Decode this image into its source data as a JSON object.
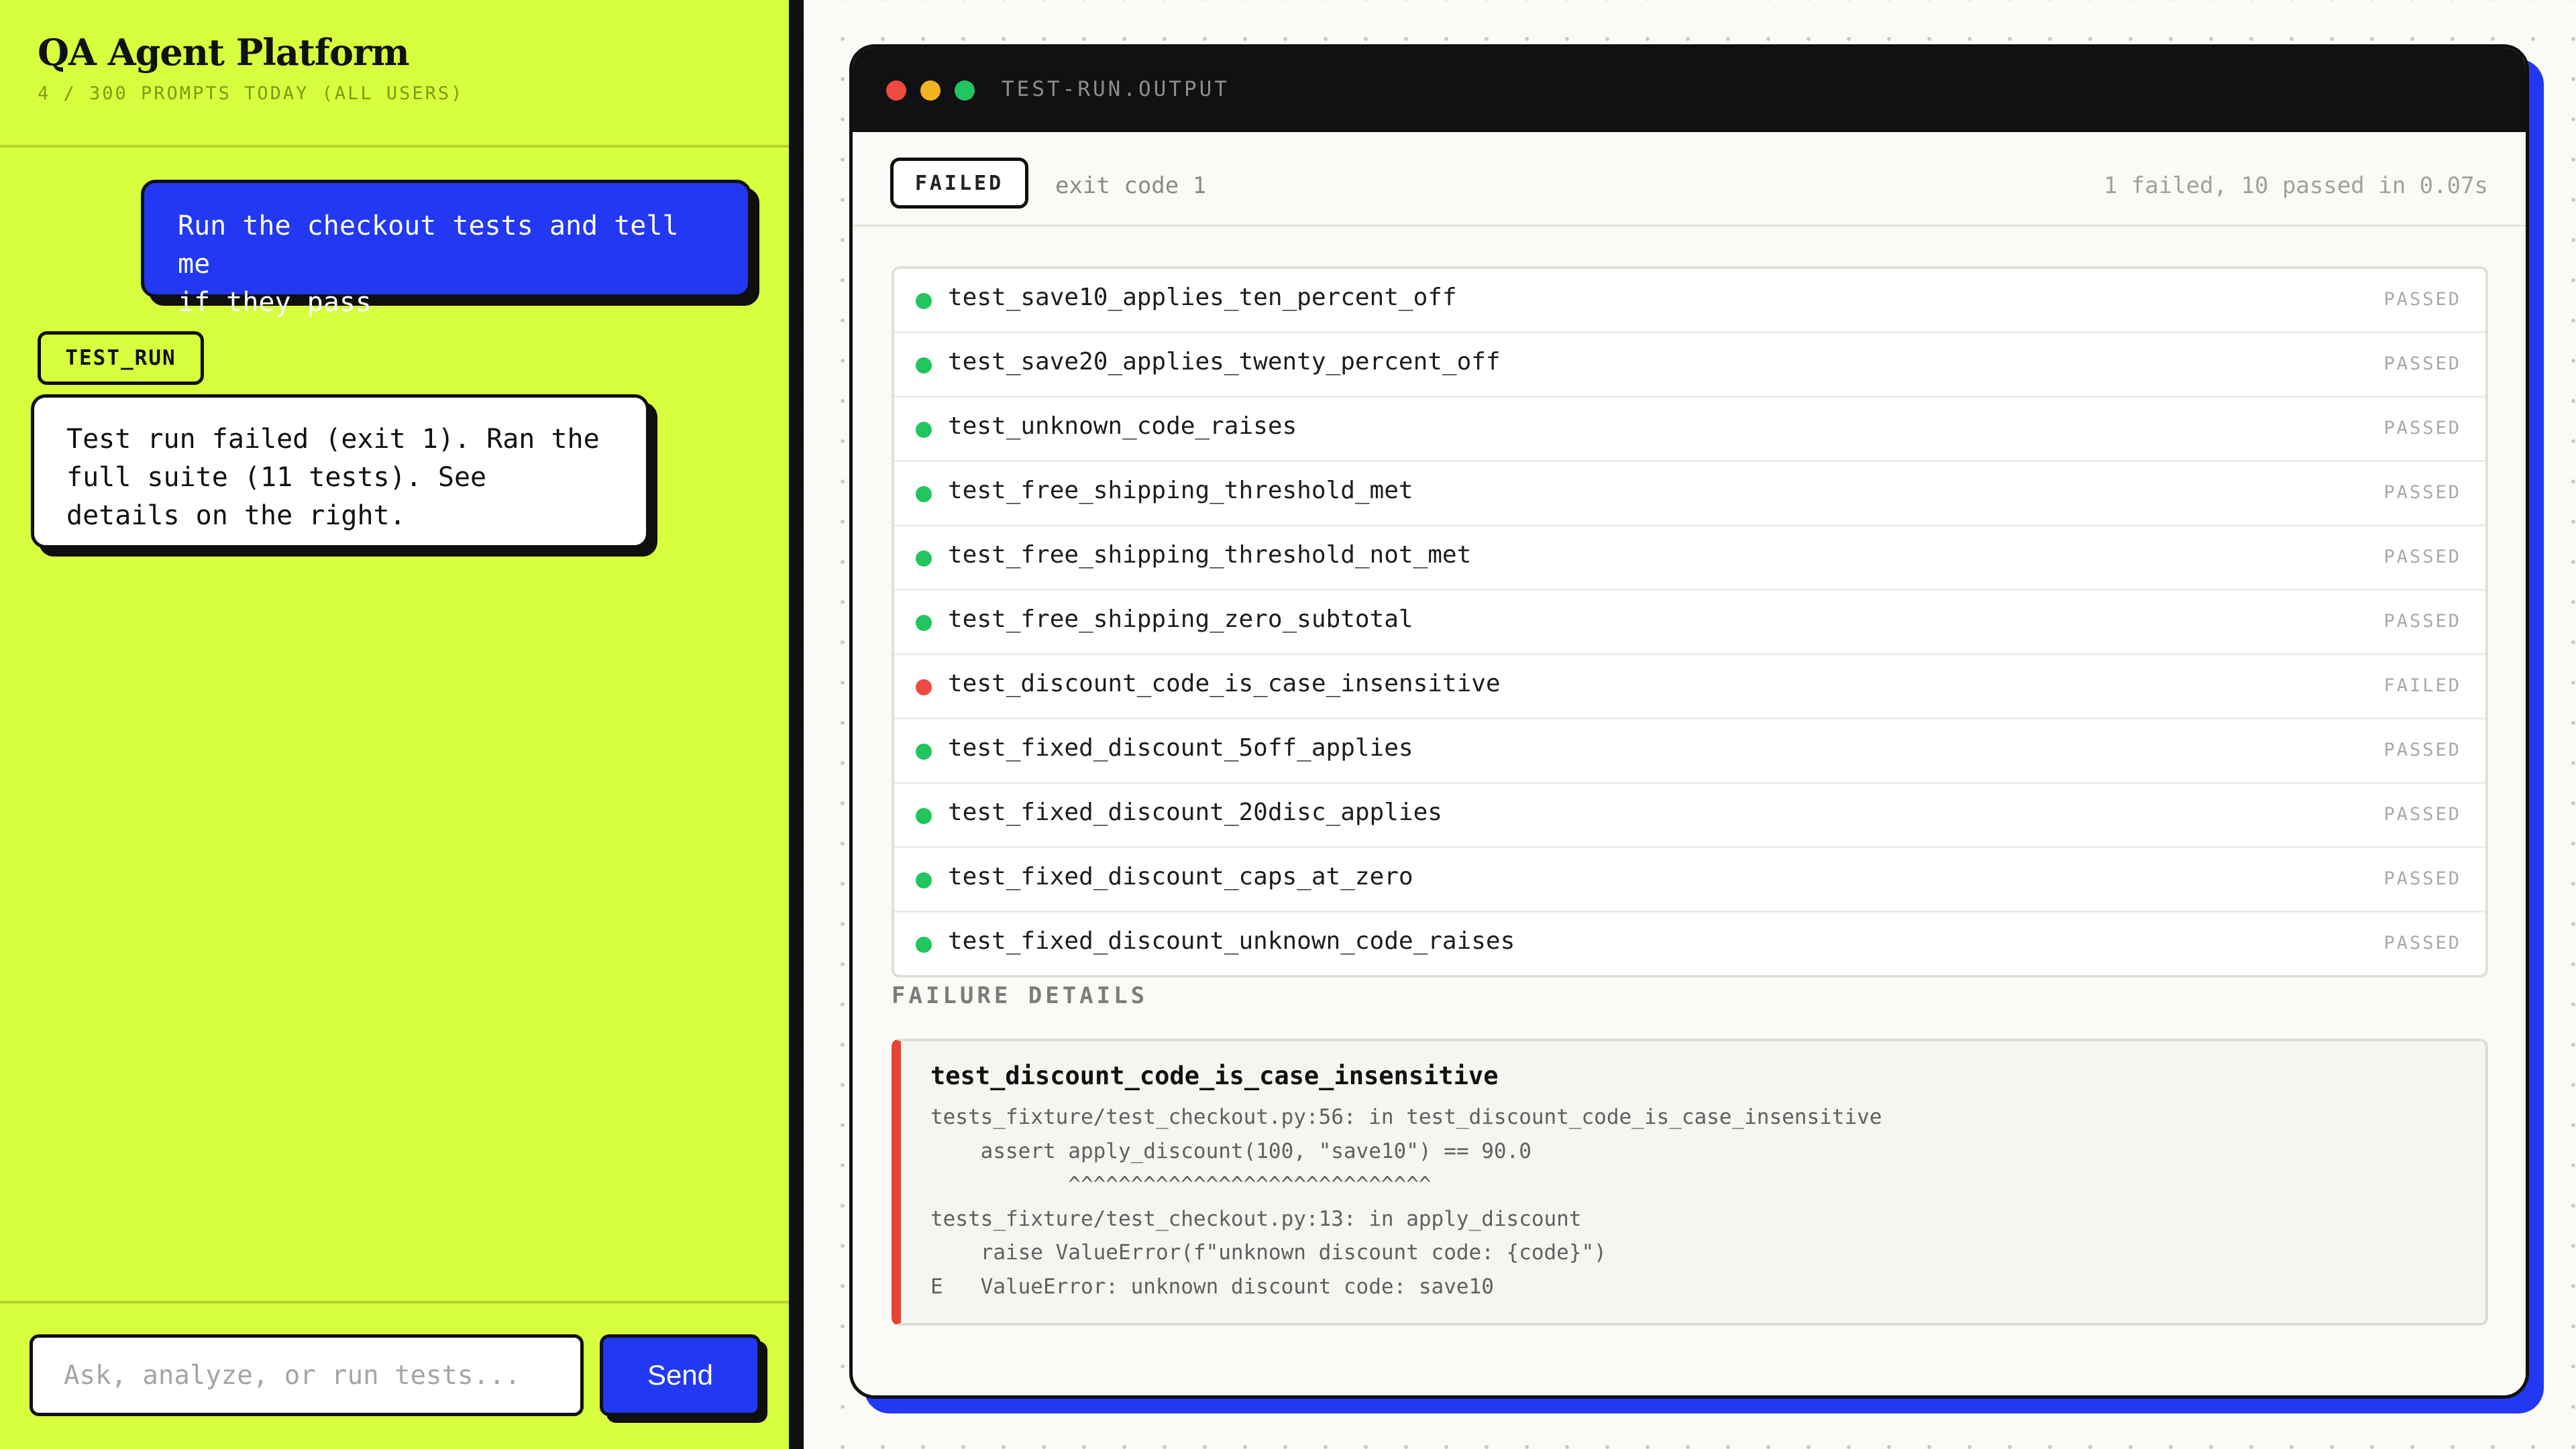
{
  "sidebar": {
    "app_title": "QA Agent Platform",
    "usage": "4 / 300 PROMPTS TODAY (ALL USERS)"
  },
  "chat": {
    "user_message": "Run the checkout tests and tell me\nif they pass",
    "tool_tag": "TEST_RUN",
    "agent_message": "Test run failed (exit 1). Ran the full suite (11 tests). See details on the right.",
    "input_placeholder": "Ask, analyze, or run tests...",
    "send_label": "Send"
  },
  "run_window": {
    "title": "TEST-RUN.OUTPUT",
    "status_badge": "FAILED",
    "exit_code": "exit code 1",
    "summary": "1 failed, 10 passed in 0.07s",
    "colors": {
      "passed": "#22c55e",
      "failed": "#ee4a3f"
    },
    "results": [
      {
        "name": "test_save10_applies_ten_percent_off",
        "status": "PASSED"
      },
      {
        "name": "test_save20_applies_twenty_percent_off",
        "status": "PASSED"
      },
      {
        "name": "test_unknown_code_raises",
        "status": "PASSED"
      },
      {
        "name": "test_free_shipping_threshold_met",
        "status": "PASSED"
      },
      {
        "name": "test_free_shipping_threshold_not_met",
        "status": "PASSED"
      },
      {
        "name": "test_free_shipping_zero_subtotal",
        "status": "PASSED"
      },
      {
        "name": "test_discount_code_is_case_insensitive",
        "status": "FAILED"
      },
      {
        "name": "test_fixed_discount_5off_applies",
        "status": "PASSED"
      },
      {
        "name": "test_fixed_discount_20disc_applies",
        "status": "PASSED"
      },
      {
        "name": "test_fixed_discount_caps_at_zero",
        "status": "PASSED"
      },
      {
        "name": "test_fixed_discount_unknown_code_raises",
        "status": "PASSED"
      }
    ],
    "failure_section_title": "FAILURE DETAILS",
    "failure": {
      "test_name": "test_discount_code_is_case_insensitive",
      "trace": "tests_fixture/test_checkout.py:56: in test_discount_code_is_case_insensitive\n    assert apply_discount(100, \"save10\") == 90.0\n           ^^^^^^^^^^^^^^^^^^^^^^^^^^^^^\ntests_fixture/test_checkout.py:13: in apply_discount\n    raise ValueError(f\"unknown discount code: {code}\")\nE   ValueError: unknown discount code: save10"
    }
  }
}
